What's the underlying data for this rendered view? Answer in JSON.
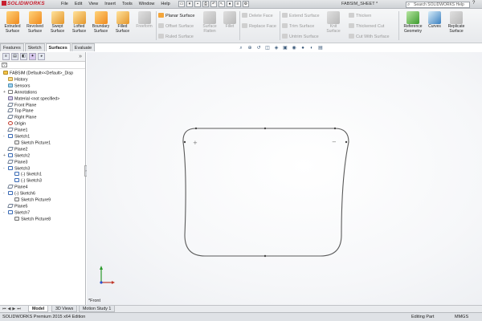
{
  "app": {
    "logo_text": "SOLIDWORKS",
    "document_title": "FABSIM_SHEET *",
    "search_placeholder": "Search SOLIDWORKS Help"
  },
  "menu": [
    "File",
    "Edit",
    "View",
    "Insert",
    "Tools",
    "Window",
    "Help"
  ],
  "ribbon": {
    "big_buttons": [
      {
        "label1": "Extruded",
        "label2": "Surface",
        "icon": "extruded-surface-icon",
        "enabled": true
      },
      {
        "label1": "Revolved",
        "label2": "Surface",
        "icon": "revolved-surface-icon",
        "enabled": true
      },
      {
        "label1": "Swept",
        "label2": "Surface",
        "icon": "swept-surface-icon",
        "enabled": true
      },
      {
        "label1": "Lofted",
        "label2": "Surface",
        "icon": "lofted-surface-icon",
        "enabled": true
      },
      {
        "label1": "Boundary",
        "label2": "Surface",
        "icon": "boundary-surface-icon",
        "enabled": true
      },
      {
        "label1": "Filled",
        "label2": "Surface",
        "icon": "filled-surface-icon",
        "enabled": true
      },
      {
        "label1": "Freeform",
        "label2": "",
        "icon": "freeform-icon",
        "enabled": false
      }
    ],
    "col1": [
      {
        "label": "Planar Surface",
        "enabled": true
      },
      {
        "label": "Offset Surface",
        "enabled": false
      },
      {
        "label": "Ruled Surface",
        "enabled": false
      }
    ],
    "surface_flatten": {
      "label1": "Surface",
      "label2": "Flatten"
    },
    "fillet": {
      "label": "Fillet"
    },
    "col2": [
      {
        "label": "Delete Face",
        "enabled": false
      },
      {
        "label": "Replace Face",
        "enabled": false
      }
    ],
    "col3": [
      {
        "label": "Extend Surface",
        "enabled": false
      },
      {
        "label": "Trim Surface",
        "enabled": false
      },
      {
        "label": "Untrim Surface",
        "enabled": false
      }
    ],
    "knit": {
      "label1": "Knit",
      "label2": "Surface"
    },
    "col4": [
      {
        "label": "Thicken",
        "enabled": false
      },
      {
        "label": "Thickened Cut",
        "enabled": false
      },
      {
        "label": "Cut With Surface",
        "enabled": false
      }
    ],
    "right_buttons": [
      {
        "label1": "Reference",
        "label2": "Geometry"
      },
      {
        "label1": "Curves",
        "label2": ""
      },
      {
        "label1": "Replicate",
        "label2": "Surface"
      }
    ]
  },
  "command_tabs": [
    "Features",
    "Sketch",
    "Surfaces",
    "Evaluate"
  ],
  "active_command_tab": "Surfaces",
  "tree": [
    {
      "label": "FABSIM  (Default<<Default>_Disp",
      "icon": "part",
      "level": 0,
      "expander": ""
    },
    {
      "label": "History",
      "icon": "folder",
      "level": 1,
      "expander": ""
    },
    {
      "label": "Sensors",
      "icon": "sensor",
      "level": 1,
      "expander": ""
    },
    {
      "label": "Annotations",
      "icon": "annot",
      "level": 1,
      "expander": "+"
    },
    {
      "label": "Material <not specified>",
      "icon": "mat",
      "level": 1,
      "expander": ""
    },
    {
      "label": "Front Plane",
      "icon": "plane",
      "level": 1,
      "expander": ""
    },
    {
      "label": "Top Plane",
      "icon": "plane",
      "level": 1,
      "expander": ""
    },
    {
      "label": "Right Plane",
      "icon": "plane",
      "level": 1,
      "expander": ""
    },
    {
      "label": "Origin",
      "icon": "origin",
      "level": 1,
      "expander": ""
    },
    {
      "label": "Plane1",
      "icon": "plane",
      "level": 1,
      "expander": ""
    },
    {
      "label": "Sketch1",
      "icon": "sketch",
      "level": 1,
      "expander": "-"
    },
    {
      "label": "Sketch Picture1",
      "icon": "pic",
      "level": 2,
      "expander": ""
    },
    {
      "label": "Plane2",
      "icon": "plane",
      "level": 1,
      "expander": ""
    },
    {
      "label": "Sketch2",
      "icon": "sketch",
      "level": 1,
      "expander": "+"
    },
    {
      "label": "Plane3",
      "icon": "plane",
      "level": 1,
      "expander": ""
    },
    {
      "label": "Sketch3",
      "icon": "sketch",
      "level": 1,
      "expander": "-"
    },
    {
      "label": "(-) Sketch1",
      "icon": "sketch",
      "level": 2,
      "expander": ""
    },
    {
      "label": "(-) Sketch3",
      "icon": "sketch",
      "level": 2,
      "expander": ""
    },
    {
      "label": "Plane4",
      "icon": "plane",
      "level": 1,
      "expander": ""
    },
    {
      "label": "(-) Sketch6",
      "icon": "sketch",
      "level": 1,
      "expander": "-"
    },
    {
      "label": "Sketch Picture9",
      "icon": "pic",
      "level": 2,
      "expander": ""
    },
    {
      "label": "Plane5",
      "icon": "plane",
      "level": 1,
      "expander": ""
    },
    {
      "label": "Sketch7",
      "icon": "sketch",
      "level": 1,
      "expander": "-"
    },
    {
      "label": "Sketch Picture8",
      "icon": "pic",
      "level": 2,
      "expander": ""
    }
  ],
  "viewport": {
    "view_label": "*Front"
  },
  "bottom_tabs": [
    "Model",
    "3D Views",
    "Motion Study 1"
  ],
  "active_bottom_tab": "Model",
  "status": {
    "version": "SOLIDWORKS Premium 2015 x64 Edition",
    "mode": "Editing Part",
    "units": "MMGS"
  },
  "colors": {
    "accent": "#c8202f",
    "sketch_line": "#555555",
    "ribbon_bg": "#eef0f2"
  }
}
